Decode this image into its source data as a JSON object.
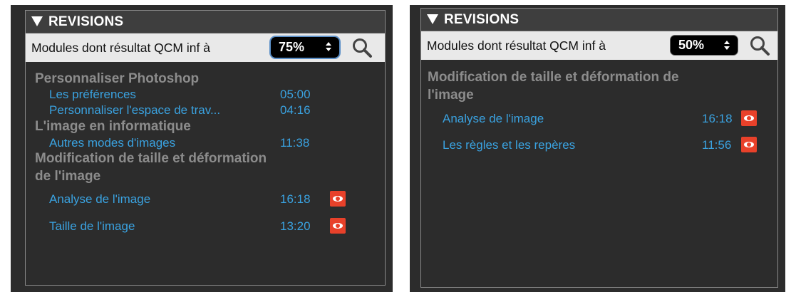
{
  "left": {
    "title": "REVISIONS",
    "filter_label": "Modules dont résultat QCM inf à",
    "threshold": "75%",
    "groups": [
      {
        "title": "Personnaliser Photoshop",
        "items": [
          {
            "label": "Les préférences",
            "time": "05:00"
          },
          {
            "label": "Personnaliser l'espace de trav...",
            "time": "04:16"
          }
        ]
      },
      {
        "title": "L'image en informatique",
        "items": [
          {
            "label": "Autres modes d'images",
            "time": "11:38"
          }
        ]
      },
      {
        "title": "Modification de taille et déformation",
        "title2": "de l'image",
        "items": [
          {
            "label": "Analyse de l'image",
            "time": "16:18"
          },
          {
            "label": "Taille de l'image",
            "time": "13:20"
          }
        ]
      }
    ]
  },
  "right": {
    "title": "REVISIONS",
    "filter_label": "Modules dont résultat QCM inf à",
    "threshold": "50%",
    "groups": [
      {
        "title": "Modification de taille et déformation de",
        "title2": "l'image",
        "items": [
          {
            "label": "Analyse de l'image",
            "time": "16:18"
          },
          {
            "label": "Les règles et les repères",
            "time": "11:56"
          }
        ]
      }
    ]
  },
  "colors": {
    "accent": "#3aa2e0",
    "eye_badge": "#e8412a",
    "group_title": "#8c8c8c",
    "panel_bg": "#2c2c2c"
  },
  "icons": {
    "collapse": "triangle-down-icon",
    "search": "search-icon",
    "eye": "eye-icon"
  }
}
